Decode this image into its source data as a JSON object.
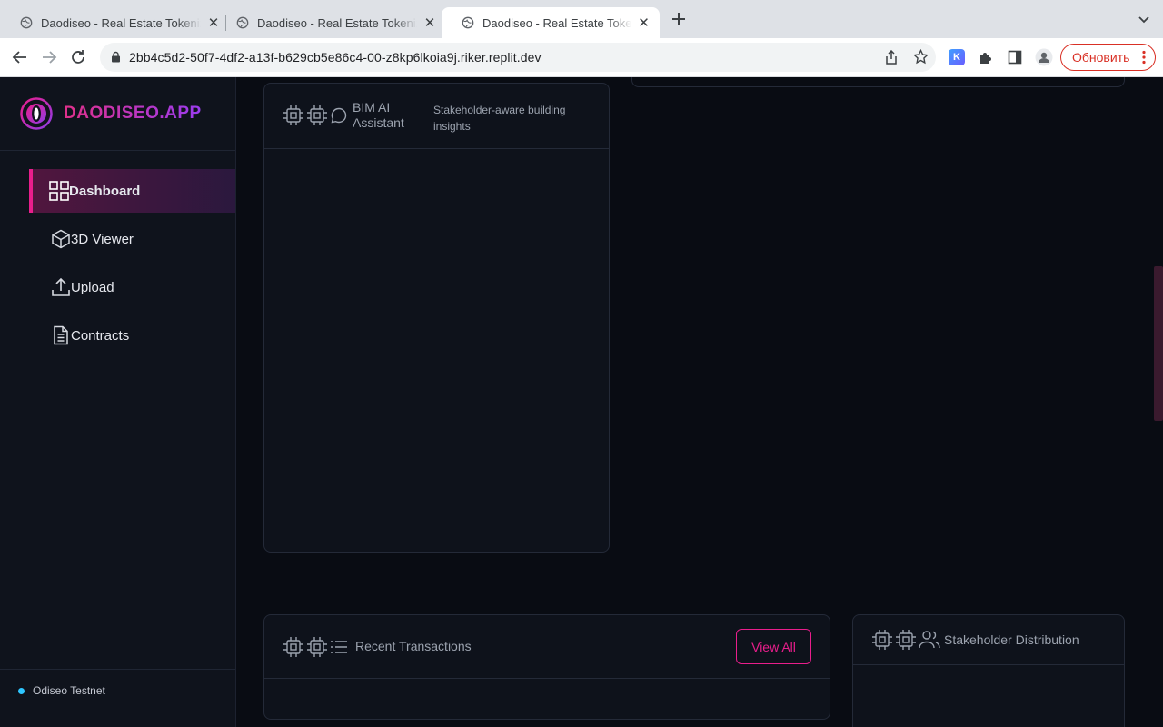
{
  "browser": {
    "tabs": [
      {
        "title": "Daodiseo - Real Estate Tokeniz",
        "active": false
      },
      {
        "title": "Daodiseo - Real Estate Tokeniz",
        "active": false
      },
      {
        "title": "Daodiseo - Real Estate Tokeniz",
        "active": true
      }
    ],
    "new_tab_icon": "plus-icon",
    "url": "2bb4c5d2-50f7-4df2-a13f-b629cb5e86c4-00-z8kp6lkoia9j.riker.replit.dev",
    "update_label": "Обновить",
    "extension_badge": "K"
  },
  "sidebar": {
    "brand": "DAODISEO.APP",
    "items": [
      {
        "label": "Dashboard",
        "icon": "grid-icon",
        "active": true
      },
      {
        "label": "3D Viewer",
        "icon": "cube-icon",
        "active": false
      },
      {
        "label": "Upload",
        "icon": "upload-icon",
        "active": false
      },
      {
        "label": "Contracts",
        "icon": "document-icon",
        "active": false
      }
    ],
    "network": "Odiseo Testnet"
  },
  "bim_card": {
    "title": "BIM AI Assistant",
    "subtitle": "Stakeholder-aware building insights"
  },
  "transactions_card": {
    "title": "Recent Transactions",
    "view_all": "View All"
  },
  "stakeholder_card": {
    "title": "Stakeholder Distribution"
  },
  "colors": {
    "accent": "#e91e8c",
    "accent_purple": "#9b3cf0",
    "background": "#090c13",
    "sidebar": "#0f131c",
    "network_dot": "#2ec6ff"
  }
}
